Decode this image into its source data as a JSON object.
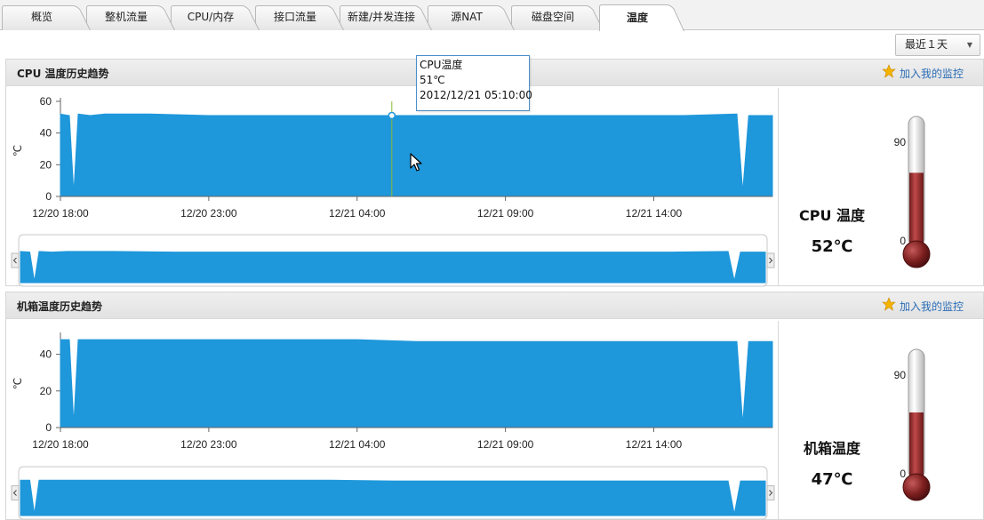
{
  "tabs": [
    {
      "label": "概览",
      "active": false
    },
    {
      "label": "整机流量",
      "active": false
    },
    {
      "label": "CPU/内存",
      "active": false
    },
    {
      "label": "接口流量",
      "active": false
    },
    {
      "label": "新建/并发连接",
      "active": false
    },
    {
      "label": "源NAT",
      "active": false
    },
    {
      "label": "磁盘空间",
      "active": false
    },
    {
      "label": "温度",
      "active": true
    }
  ],
  "range_select": {
    "value": "最近１天"
  },
  "panels": [
    {
      "title": "CPU 温度历史趋势",
      "watch_label": "加入我的监控",
      "gauge_label": "CPU 温度",
      "gauge_value": "52℃",
      "gauge_max_label": "90",
      "gauge_min_label": "0",
      "gauge_fill_fraction": 0.578
    },
    {
      "title": "机箱温度历史趋势",
      "watch_label": "加入我的监控",
      "gauge_label": "机箱温度",
      "gauge_value": "47℃",
      "gauge_max_label": "90",
      "gauge_min_label": "0",
      "gauge_fill_fraction": 0.522
    }
  ],
  "tooltip": {
    "series": "CPU温度",
    "value": "51℃",
    "time": "2012/12/21 05:10:00"
  },
  "colors": {
    "series_fill": "#1f97db",
    "tooltip_border": "#4a90c9",
    "crosshair": "#8fbc2f",
    "thermo_mercury": "#8e2a2a",
    "link": "#2a6db7",
    "star": "#f5b301"
  },
  "icons": {
    "star": "star-icon",
    "cursor": "mouse-pointer-icon",
    "scroll_left": "chevron-left-icon",
    "scroll_right": "chevron-right-icon",
    "dropdown": "chevron-down-icon"
  },
  "chart_data": [
    {
      "type": "area",
      "ylabel": "℃",
      "ylim": [
        0,
        60
      ],
      "yticks": [
        0,
        20,
        40,
        60
      ],
      "xticks": [
        "12/20 18:00",
        "12/20 23:00",
        "12/21 04:00",
        "12/21 09:00",
        "12/21 14:00"
      ],
      "x_hours": [
        0,
        0.3,
        0.45,
        0.6,
        1.0,
        1.5,
        3,
        5,
        7,
        10,
        13,
        15,
        18,
        21,
        22.8,
        23.0,
        23.2,
        23.5,
        24
      ],
      "values": [
        52,
        51,
        2,
        52,
        51,
        52,
        52,
        51,
        51,
        51,
        51,
        51,
        51,
        51,
        52,
        3,
        51,
        51,
        51
      ],
      "cursor_time_hours": 11.17,
      "cursor_value": 51
    },
    {
      "type": "area",
      "ylabel": "℃",
      "ylim": [
        0,
        50
      ],
      "yticks": [
        0,
        20,
        40
      ],
      "xticks": [
        "12/20 18:00",
        "12/20 23:00",
        "12/21 04:00",
        "12/21 09:00",
        "12/21 14:00"
      ],
      "x_hours": [
        0,
        0.3,
        0.45,
        0.6,
        1.0,
        3,
        7,
        10,
        12,
        15,
        18,
        21,
        22.8,
        23.0,
        23.2,
        23.5,
        24
      ],
      "values": [
        48,
        48,
        2,
        48,
        48,
        48,
        48,
        48,
        47,
        47,
        47,
        47,
        47,
        2,
        47,
        47,
        47
      ]
    }
  ]
}
